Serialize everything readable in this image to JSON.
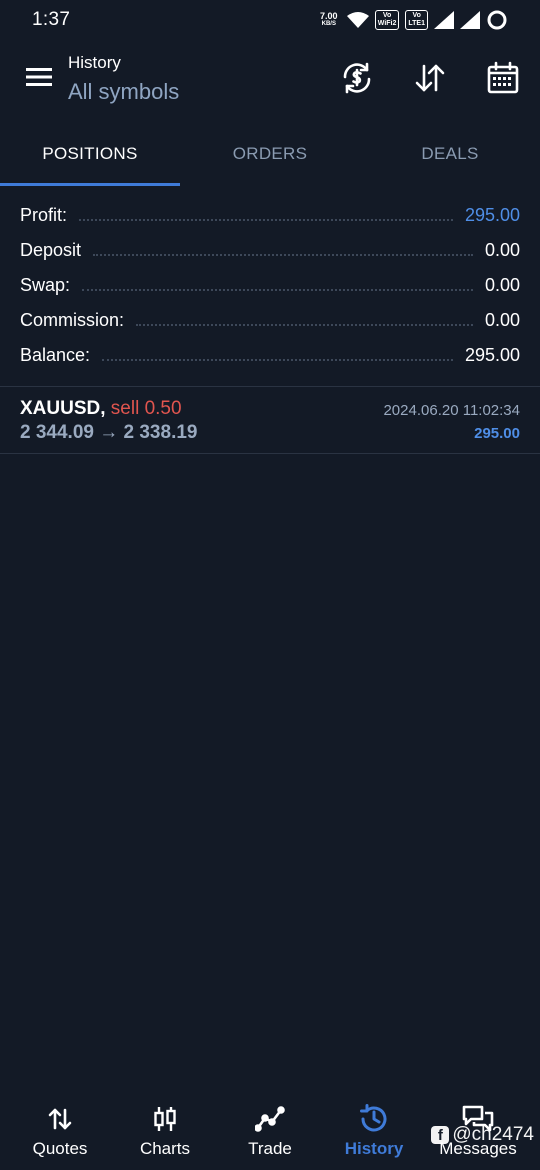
{
  "status_bar": {
    "time": "1:37",
    "net_speed_value": "7.00",
    "net_speed_unit": "KB/S",
    "sim1_top": "Vo",
    "sim1_bottom": "WiFi2",
    "sim2_top": "Vo",
    "sim2_bottom": "LTE1"
  },
  "header": {
    "title": "History",
    "subtitle": "All symbols",
    "icons": [
      "menu-icon",
      "currency-sync-icon",
      "sort-icon",
      "calendar-icon"
    ]
  },
  "tabs": [
    {
      "label": "POSITIONS",
      "active": true
    },
    {
      "label": "ORDERS",
      "active": false
    },
    {
      "label": "DEALS",
      "active": false
    }
  ],
  "summary": [
    {
      "label": "Profit:",
      "value": "295.00"
    },
    {
      "label": "Deposit",
      "value": "0.00"
    },
    {
      "label": "Swap:",
      "value": "0.00"
    },
    {
      "label": "Commission:",
      "value": "0.00"
    },
    {
      "label": "Balance:",
      "value": "295.00"
    }
  ],
  "positions": [
    {
      "symbol": "XAUUSD,",
      "side": "sell 0.50",
      "prices": "2 344.09 → 2 338.19",
      "datetime": "2024.06.20 11:02:34",
      "profit": "295.00"
    }
  ],
  "bottom_nav": [
    {
      "label": "Quotes",
      "icon": "quotes-icon",
      "active": false
    },
    {
      "label": "Charts",
      "icon": "candlestick-icon",
      "active": false
    },
    {
      "label": "Trade",
      "icon": "trade-icon",
      "active": false
    },
    {
      "label": "History",
      "icon": "history-icon",
      "active": true
    },
    {
      "label": "Messages",
      "icon": "messages-icon",
      "active": false
    }
  ],
  "watermark": {
    "text": "@ch2474"
  },
  "colors": {
    "background": "#131a26",
    "accent": "#3f7bd8",
    "profit_blue": "#4f8ee6",
    "sell_red": "#e0554f",
    "muted": "#8a9bb1"
  }
}
